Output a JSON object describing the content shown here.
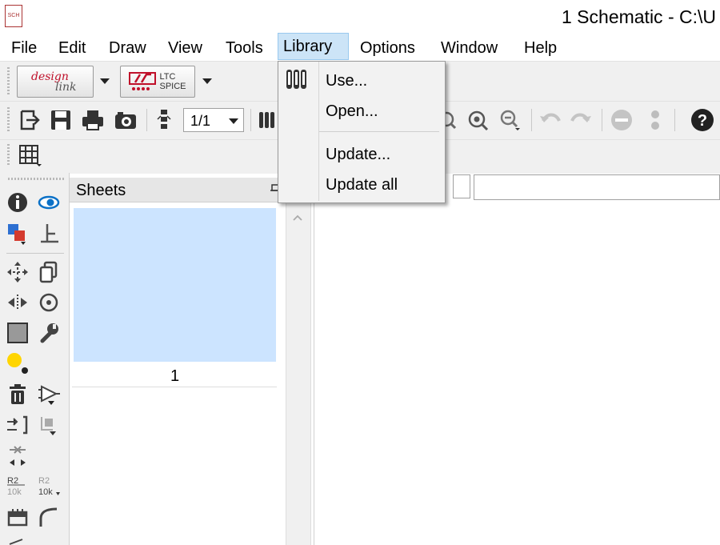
{
  "window": {
    "title": "1 Schematic - C:\\U",
    "app_icon_text": "SCH"
  },
  "menubar": {
    "items": [
      {
        "label": "File",
        "active": false
      },
      {
        "label": "Edit",
        "active": false
      },
      {
        "label": "Draw",
        "active": false
      },
      {
        "label": "View",
        "active": false
      },
      {
        "label": "Tools",
        "active": false
      },
      {
        "label": "Library",
        "active": true
      },
      {
        "label": "Options",
        "active": false
      },
      {
        "label": "Window",
        "active": false
      },
      {
        "label": "Help",
        "active": false
      }
    ]
  },
  "toolbar": {
    "designlink_label_top": "design",
    "designlink_label_bottom": "link",
    "ltspice_label_top": "LTC",
    "ltspice_label_bottom": "SPICE",
    "page_select_value": "1/1"
  },
  "library_menu": {
    "items": [
      {
        "label": "Use...",
        "icon": "library-icon"
      },
      {
        "label": "Open...",
        "icon": ""
      },
      {
        "label": "Update...",
        "icon": ""
      },
      {
        "label": "Update all",
        "icon": ""
      }
    ]
  },
  "sheets_panel": {
    "title": "Sheets",
    "sheet_number": "1"
  },
  "colors": {
    "menu_active_bg": "#cce4f7",
    "sheet_thumb_bg": "#cce4ff",
    "toolbar_bg": "#f0f0f0",
    "brand_red": "#c0102a"
  }
}
